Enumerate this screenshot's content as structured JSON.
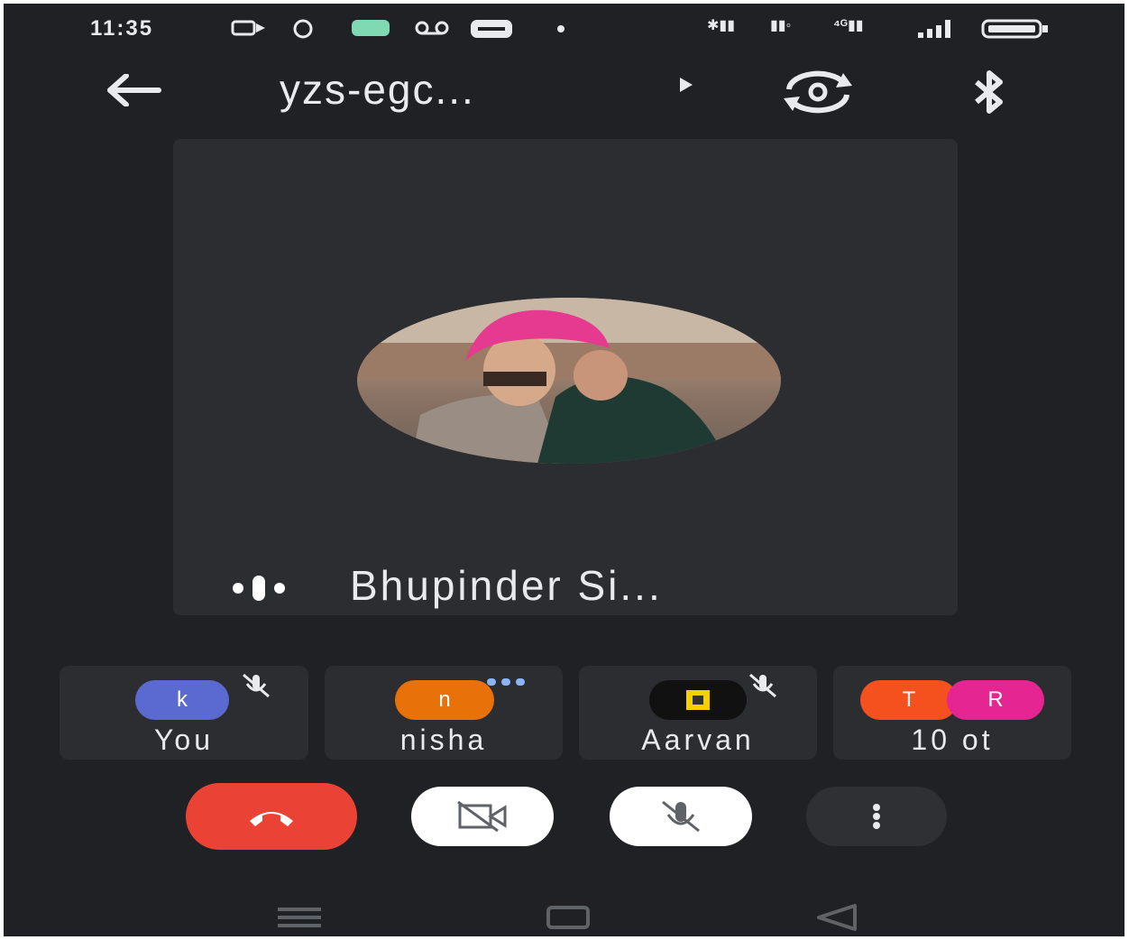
{
  "status_bar": {
    "time": "11:35"
  },
  "top_bar": {
    "meeting_title": "yzs-egc..."
  },
  "main_tile": {
    "speaker_name": "Bhupinder Si..."
  },
  "participants": [
    {
      "initial": "k",
      "name": "You",
      "avatar_color": "#5b6ad0",
      "muted": true
    },
    {
      "initial": "n",
      "name": "nisha",
      "avatar_color": "#e8710a",
      "speaking": true
    },
    {
      "initial": "",
      "name": "Aarvan",
      "avatar_color": "#111111",
      "muted": true
    },
    {
      "initials": [
        "T",
        "R"
      ],
      "name": "10 ot",
      "avatar_colors": [
        "#f4511e",
        "#e52592"
      ]
    }
  ],
  "controls": {
    "end_call_color": "#ea4335"
  }
}
